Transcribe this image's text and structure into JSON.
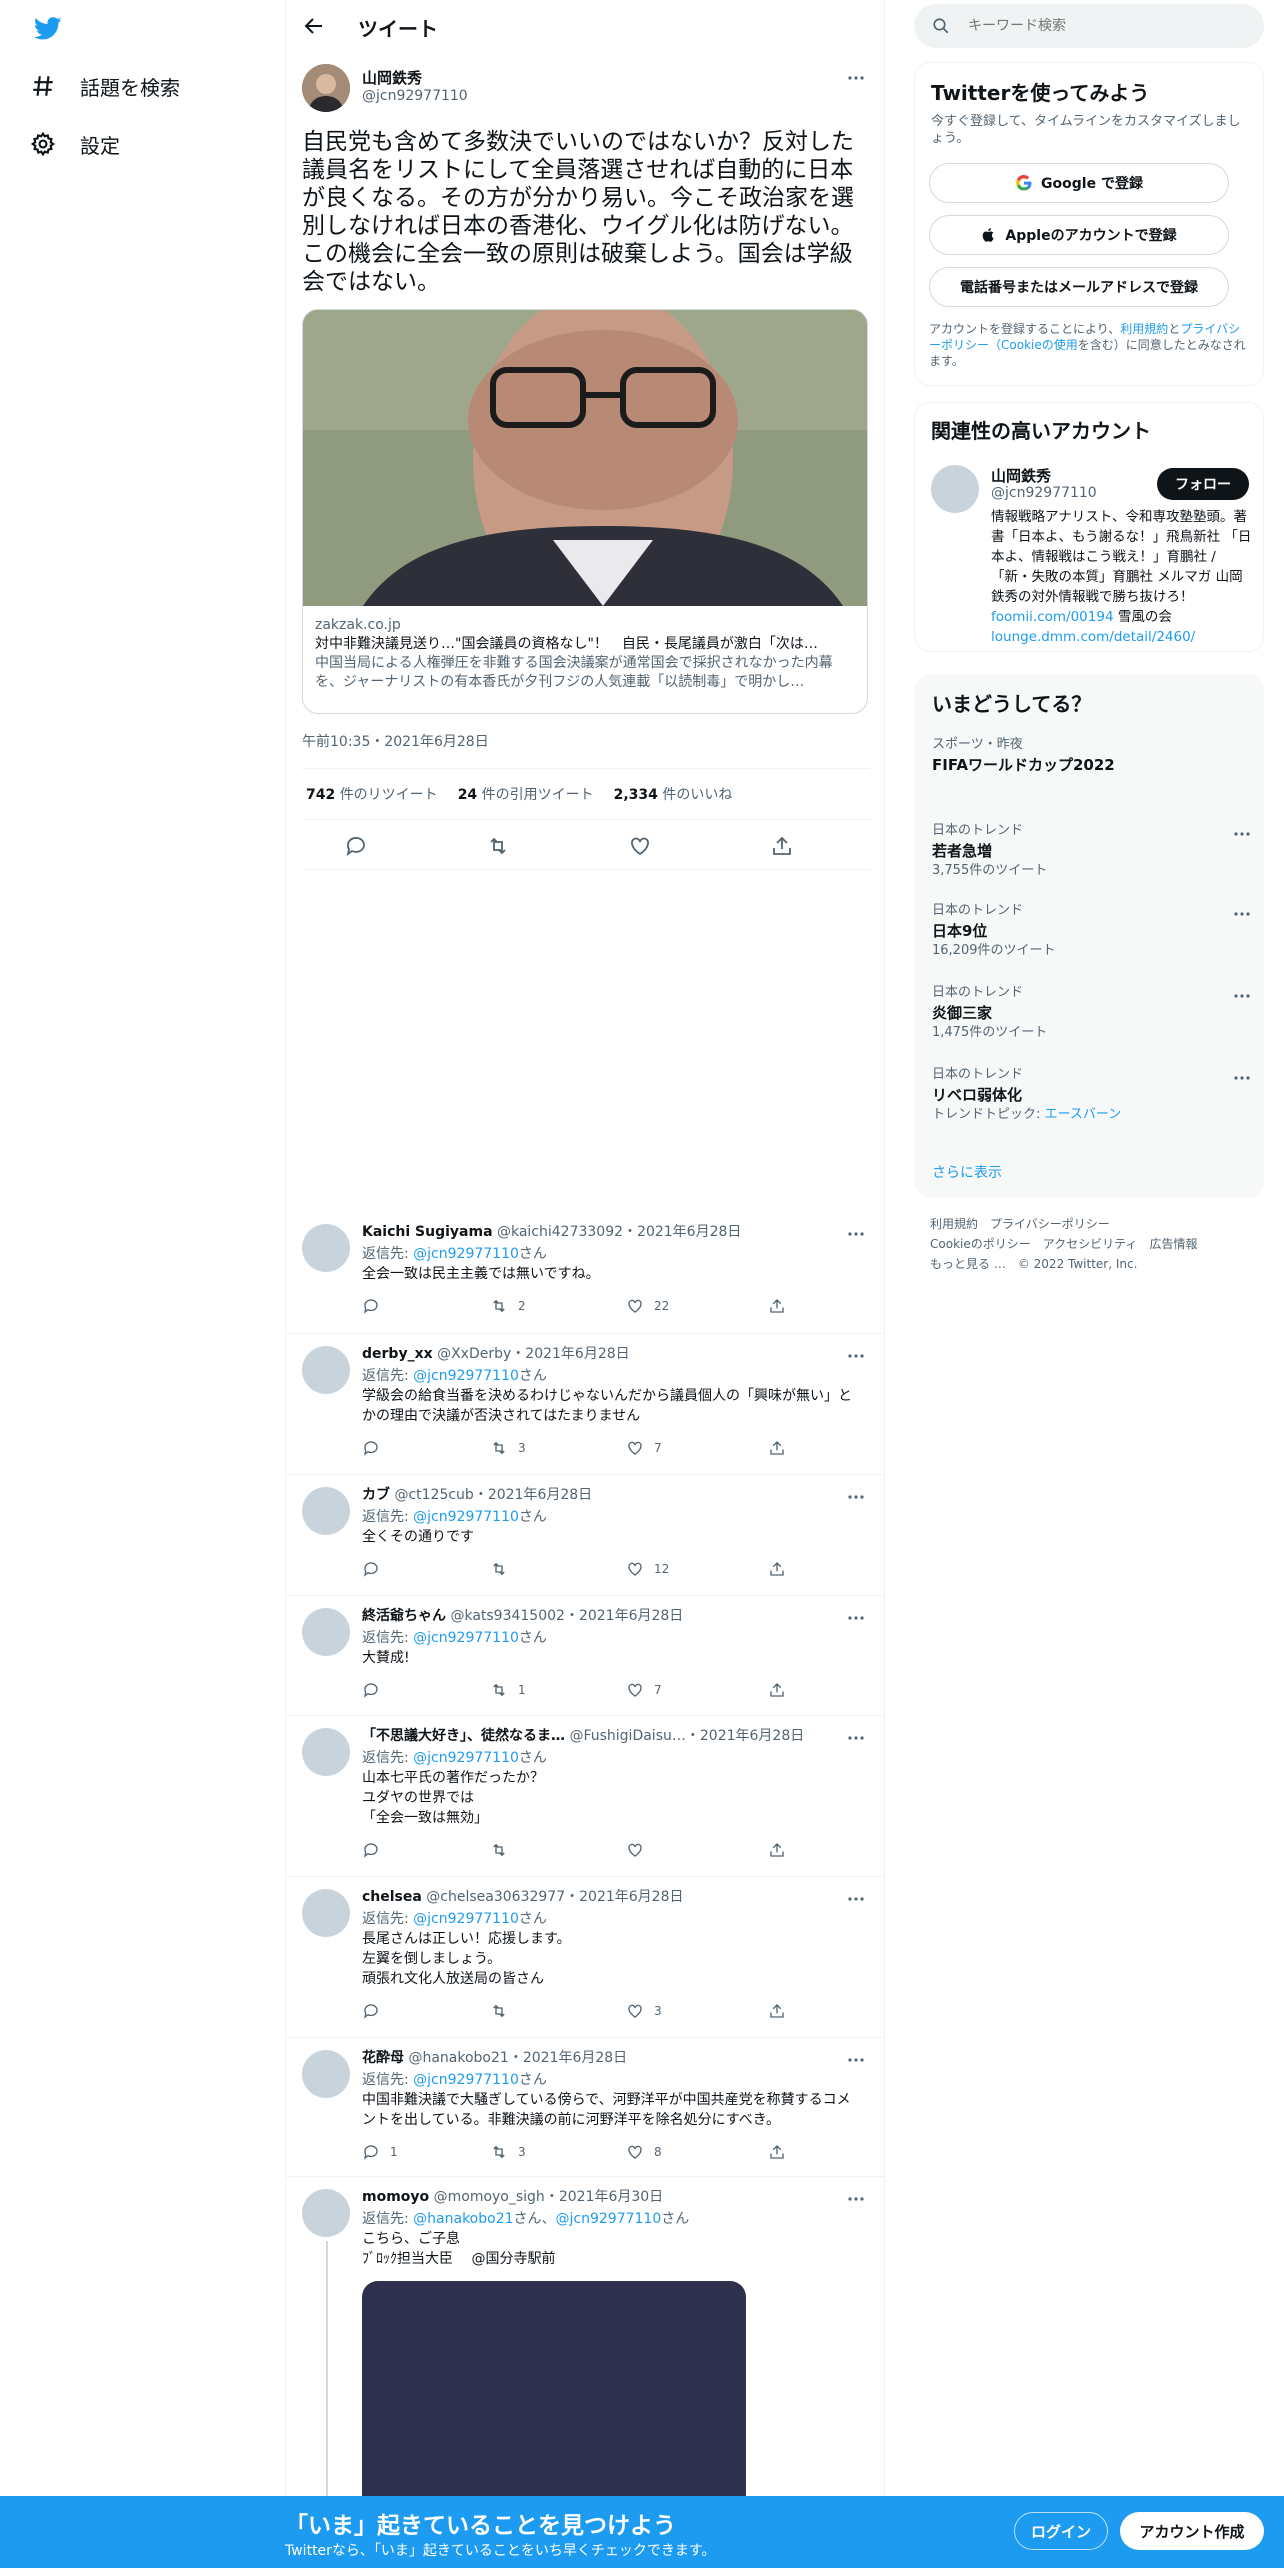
{
  "nav": {
    "explore_label": "話題を検索",
    "settings_label": "設定"
  },
  "header": {
    "title": "ツイート"
  },
  "tweet": {
    "author_name": "山岡鉄秀",
    "author_handle": "@jcn92977110",
    "text": "自民党も含めて多数決でいいのではないか？反対した議員名をリストにして全員落選させれば自動的に日本が良くなる。その方が分かり易い。今こそ政治家を選別しなければ日本の香港化、ウイグル化は防げない。この機会に全会一致の原則は破棄しよう。国会は学級会ではない。",
    "card": {
      "domain": "zakzak.co.jp",
      "title": "対中非難決議見送り…\"国会議員の資格なし\"！　自民・長尾議員が激白「次は…",
      "desc": "中国当局による人権弾圧を非難する国会決議案が通常国会で採択されなかった内幕を、ジャーナリストの有本香氏が夕刊フジの人気連載「以読制毒」で明かし…"
    },
    "timestamp": "午前10:35・2021年6月28日",
    "retweets": "742",
    "retweets_label": "件のリツイート",
    "quotes": "24",
    "quotes_label": "件の引用ツイート",
    "likes": "2,334",
    "likes_label": "件のいいね"
  },
  "replies": [
    {
      "name": "Kaichi Sugiyama",
      "handle": "@kaichi42733092",
      "date": "2021年6月28日",
      "reply_prefix": "返信先: ",
      "reply_to": "@jcn92977110",
      "reply_suffix": "さん",
      "text": "全会一致は民主主義では無いですね。",
      "replies": "",
      "retweets": "2",
      "likes": "22"
    },
    {
      "name": "derby_xx",
      "handle": "@XxDerby",
      "date": "2021年6月28日",
      "reply_prefix": "返信先: ",
      "reply_to": "@jcn92977110",
      "reply_suffix": "さん",
      "text": "学級会の給食当番を決めるわけじゃないんだから議員個人の「興味が無い」とかの理由で決議が否決されてはたまりません",
      "replies": "",
      "retweets": "3",
      "likes": "7"
    },
    {
      "name": "カブ",
      "handle": "@ct125cub",
      "date": "2021年6月28日",
      "reply_prefix": "返信先: ",
      "reply_to": "@jcn92977110",
      "reply_suffix": "さん",
      "text": "全くその通りです",
      "replies": "",
      "retweets": "",
      "likes": "12"
    },
    {
      "name": "終活爺ちゃん",
      "handle": "@kats93415002",
      "date": "2021年6月28日",
      "reply_prefix": "返信先: ",
      "reply_to": "@jcn92977110",
      "reply_suffix": "さん",
      "text": "大賛成!",
      "replies": "",
      "retweets": "1",
      "likes": "7"
    },
    {
      "name": "「不思議大好き」、徒然なるま…",
      "handle": "@FushigiDaisu…",
      "date": "2021年6月28日",
      "reply_prefix": "返信先: ",
      "reply_to": "@jcn92977110",
      "reply_suffix": "さん",
      "text": "山本七平氏の著作だったか？\nユダヤの世界では\n「全会一致は無効」",
      "replies": "",
      "retweets": "",
      "likes": ""
    },
    {
      "name": "chelsea",
      "handle": "@chelsea30632977",
      "date": "2021年6月28日",
      "reply_prefix": "返信先: ",
      "reply_to": "@jcn92977110",
      "reply_suffix": "さん",
      "text": "長尾さんは正しい！応援します。\n左翼を倒しましょう。\n頑張れ文化人放送局の皆さん",
      "replies": "",
      "retweets": "",
      "likes": "3"
    },
    {
      "name": "花酔母",
      "handle": "@hanakobo21",
      "date": "2021年6月28日",
      "reply_prefix": "返信先: ",
      "reply_to": "@jcn92977110",
      "reply_suffix": "さん",
      "text": "中国非難決議で大騒ぎしている傍らで、河野洋平が中国共産党を称賛するコメントを出している。非難決議の前に河野洋平を除名処分にすべき。",
      "replies": "1",
      "retweets": "3",
      "likes": "8"
    },
    {
      "name": "momoyo",
      "handle": "@momoyo_sigh",
      "date": "2021年6月30日",
      "reply_prefix": "返信先: ",
      "reply_to": "@hanakobo21",
      "reply_to2": "@jcn92977110",
      "reply_mid": "さん、",
      "reply_suffix": "さん",
      "text": "こちら、ご子息\nﾌﾞﾛｯｸ担当大臣　 @国分寺駅前",
      "replies": "",
      "retweets": "",
      "likes": ""
    }
  ],
  "right": {
    "search_placeholder": "キーワード検索",
    "signup": {
      "title": "Twitterを使ってみよう",
      "subtitle": "今すぐ登録して、タイムラインをカスタマイズしましょう。",
      "google_label": "Google で登録",
      "apple_label": "Appleのアカウントで登録",
      "phone_label": "電話番号またはメールアドレスで登録",
      "legal_pre": "アカウントを登録することにより、",
      "legal_terms": "利用規約",
      "legal_and": "と",
      "legal_privacy": "プライバシーポリシー（Cookieの使用",
      "legal_post": "を含む）に同意したとみなされます。"
    },
    "related": {
      "title": "関連性の高いアカウント",
      "name": "山岡鉄秀",
      "handle": "@jcn92977110",
      "follow_label": "フォロー",
      "bio_1": "情報戦略アナリスト、令和専攻塾塾頭。著書「日本よ、もう謝るな！」飛鳥新社 「日本よ、情報戦はこう戦え！」育鵬社 /「新・失敗の本質」育鵬社 メルマガ 山岡鉄秀の対外情報戦で勝ち抜けろ！ ",
      "bio_link1": "foomii.com/00194",
      "bio_2": " 雪風の会",
      "bio_link2": "lounge.dmm.com/detail/2460/"
    },
    "trends": {
      "title": "いまどうしてる？",
      "items": [
        {
          "context": "スポーツ・昨夜",
          "name": "FIFAワールドカップ2022",
          "meta": ""
        },
        {
          "context": "日本のトレンド",
          "name": "若者急増",
          "meta": "3,755件のツイート"
        },
        {
          "context": "日本のトレンド",
          "name": "日本9位",
          "meta": "16,209件のツイート"
        },
        {
          "context": "日本のトレンド",
          "name": "炎御三家",
          "meta": "1,475件のツイート"
        },
        {
          "context": "日本のトレンド",
          "name": "リベロ弱体化",
          "meta_prefix": "トレンドトピック: ",
          "meta_link": "エースバーン"
        }
      ],
      "show_more": "さらに表示"
    },
    "footer": {
      "terms": "利用規約",
      "privacy": "プライバシーポリシー",
      "cookie": "Cookieのポリシー",
      "accessibility": "アクセシビリティ",
      "ads": "広告情報",
      "more": "もっと見る …",
      "copyright": "© 2022 Twitter, Inc."
    }
  },
  "bottom_bar": {
    "headline": "「いま」起きていることを見つけよう",
    "sub": "Twitterなら、「いま」起きていることをいち早くチェックできます。",
    "login": "ログイン",
    "signup": "アカウント作成"
  },
  "colors": {
    "brand": "#1d9bf0",
    "text": "#0f1419",
    "muted": "#536471",
    "border": "#eff3f4"
  }
}
